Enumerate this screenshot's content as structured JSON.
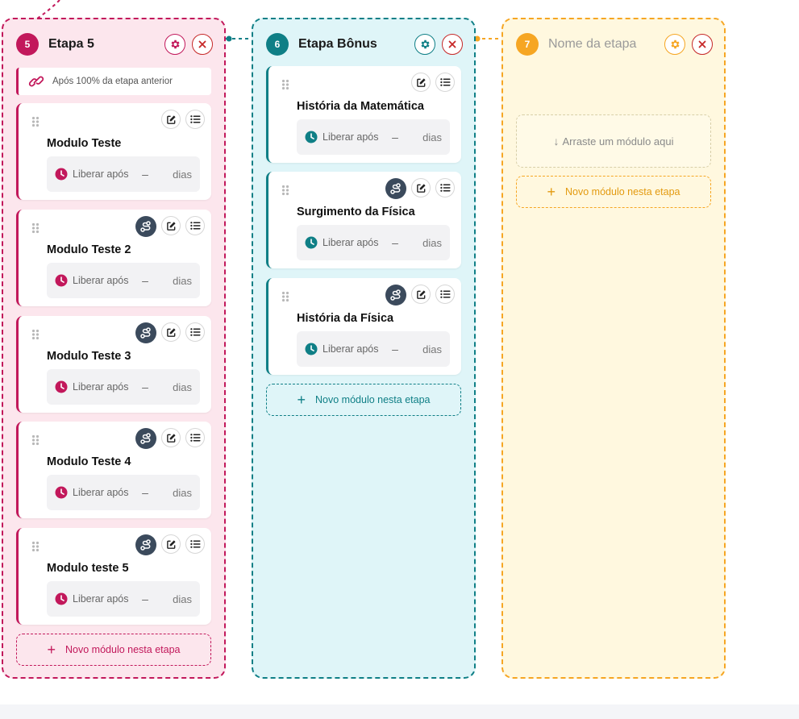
{
  "colors": {
    "pink": "#c2185b",
    "teal": "#0f7f86",
    "yellow": "#f6a623",
    "route": "#3b4a5c"
  },
  "columns": [
    {
      "number": "5",
      "title": "Etapa 5",
      "prerequisite": "Após 100% da etapa anterior",
      "modules": [
        {
          "title": "Modulo Teste",
          "release": "Liberar após",
          "dash": "–",
          "unit": "dias"
        },
        {
          "title": "Modulo Teste 2",
          "release": "Liberar após",
          "dash": "–",
          "unit": "dias"
        },
        {
          "title": "Modulo Teste 3",
          "release": "Liberar após",
          "dash": "–",
          "unit": "dias"
        },
        {
          "title": "Modulo Teste 4",
          "release": "Liberar após",
          "dash": "–",
          "unit": "dias"
        },
        {
          "title": "Modulo teste 5",
          "release": "Liberar após",
          "dash": "–",
          "unit": "dias"
        }
      ],
      "new_module": "Novo módulo nesta etapa"
    },
    {
      "number": "6",
      "title": "Etapa Bônus",
      "modules": [
        {
          "title": "História da Matemática",
          "release": "Liberar após",
          "dash": "–",
          "unit": "dias"
        },
        {
          "title": "Surgimento da Física",
          "release": "Liberar após",
          "dash": "–",
          "unit": "dias"
        },
        {
          "title": "História da Física",
          "release": "Liberar após",
          "dash": "–",
          "unit": "dias"
        }
      ],
      "new_module": "Novo módulo nesta etapa"
    },
    {
      "number": "7",
      "title": "Nome da etapa",
      "drop_zone": "Arraste um módulo aqui",
      "new_module": "Novo módulo nesta etapa"
    }
  ],
  "icons": {
    "add": "+",
    "drop_arrow": "↓",
    "names": [
      "gear-icon",
      "close-icon",
      "link-icon",
      "drag-handle-icon",
      "route-icon",
      "edit-icon",
      "list-icon",
      "clock-icon",
      "arrow-down-icon",
      "plus-icon"
    ]
  }
}
